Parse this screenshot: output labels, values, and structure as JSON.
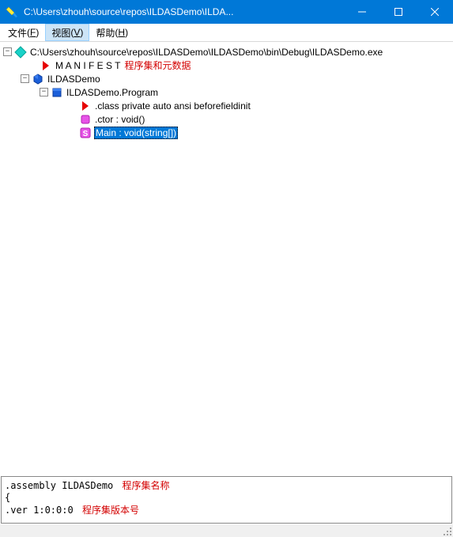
{
  "titlebar": {
    "title": "C:\\Users\\zhouh\\source\\repos\\ILDASDemo\\ILDA..."
  },
  "menubar": {
    "file": "文件",
    "file_accel": "F",
    "view": "视图",
    "view_accel": "V",
    "help": "帮助",
    "help_accel": "H"
  },
  "tree": {
    "root": {
      "label": "C:\\Users\\zhouh\\source\\repos\\ILDASDemo\\ILDASDemo\\bin\\Debug\\ILDASDemo.exe",
      "children": {
        "manifest": {
          "label": "M A N I F E S T",
          "annot": "程序集和元数据"
        },
        "assembly": {
          "label": "ILDASDemo",
          "children": {
            "program": {
              "label": "ILDASDemo.Program",
              "children": {
                "classinfo": {
                  "label": ".class private auto ansi beforefieldinit"
                },
                "ctor": {
                  "label": ".ctor : void()"
                },
                "main": {
                  "label": "Main : void(string[])"
                }
              }
            }
          }
        }
      }
    }
  },
  "bottom": {
    "line1_a": ".assembly ILDASDemo",
    "line1_annot": "程序集名称",
    "line2": "{",
    "line3_a": "  .ver 1:0:0:0",
    "line3_annot": "程序集版本号"
  }
}
